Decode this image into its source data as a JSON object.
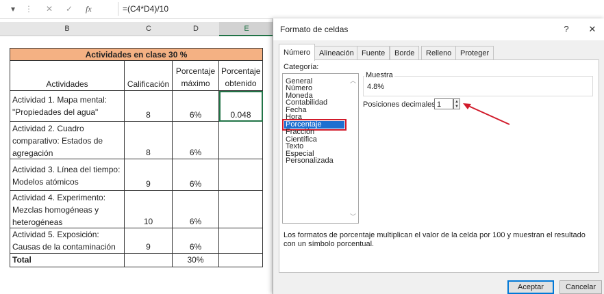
{
  "formula_bar": {
    "dropdown_glyph": "▾",
    "separator_glyph": "⋮",
    "cancel_glyph": "✕",
    "confirm_glyph": "✓",
    "fx_label": "fx",
    "formula": "=(C4*D4)/10"
  },
  "sheet": {
    "columns": [
      "B",
      "C",
      "D",
      "E"
    ],
    "selected_column": "E",
    "title": "Actividades en clase 30 %",
    "title_fill": "#f4b183",
    "headers": {
      "activity": "Actividades",
      "grade": "Calificación",
      "max_pct_1": "Porcentaje",
      "max_pct_2": "máximo",
      "obtained_pct_1": "Porcentaje",
      "obtained_pct_2": "obtenido"
    },
    "rows": [
      {
        "activity_lines": [
          "Actividad 1. Mapa mental:",
          "\"Propiedades del agua\""
        ],
        "grade": "8",
        "max": "6%",
        "obtained": "0.048"
      },
      {
        "activity_lines": [
          "Actividad 2. Cuadro",
          "comparativo: Estados de",
          "agregación"
        ],
        "grade": "8",
        "max": "6%",
        "obtained": ""
      },
      {
        "activity_lines": [
          "Actividad 3. Línea del tiempo:",
          "Modelos atómicos"
        ],
        "grade": "9",
        "max": "6%",
        "obtained": ""
      },
      {
        "activity_lines": [
          "Actividad 4.  Experimento:",
          "Mezclas homogéneas y",
          "heterogéneas"
        ],
        "grade": "10",
        "max": "6%",
        "obtained": ""
      },
      {
        "activity_lines": [
          "Actividad 5. Exposición:",
          "Causas de la contaminación"
        ],
        "grade": "9",
        "max": "6%",
        "obtained": ""
      }
    ],
    "total_label": "Total",
    "total_max": "30%"
  },
  "dialog": {
    "title": "Formato de celdas",
    "help_glyph": "?",
    "close_glyph": "✕",
    "tabs": [
      "Número",
      "Alineación",
      "Fuente",
      "Borde",
      "Relleno",
      "Proteger"
    ],
    "active_tab": "Número",
    "category_label": "Categoría:",
    "categories": [
      "General",
      "Número",
      "Moneda",
      "Contabilidad",
      "Fecha",
      "Hora",
      "Porcentaje",
      "Fracción",
      "Científica",
      "Texto",
      "Especial",
      "Personalizada"
    ],
    "selected_category": "Porcentaje",
    "sample_label": "Muestra",
    "sample_value": "4.8%",
    "decimals_label": "Posiciones decimales:",
    "decimals_value": "1",
    "description": "Los formatos de porcentaje multiplican el valor de la celda por 100 y muestran el resultado con un símbolo porcentual.",
    "accept_label": "Aceptar",
    "cancel_label": "Cancelar"
  },
  "colors": {
    "highlight_red": "#d11a2a",
    "selection_blue": "#1e6fd0",
    "excel_green": "#217346"
  }
}
